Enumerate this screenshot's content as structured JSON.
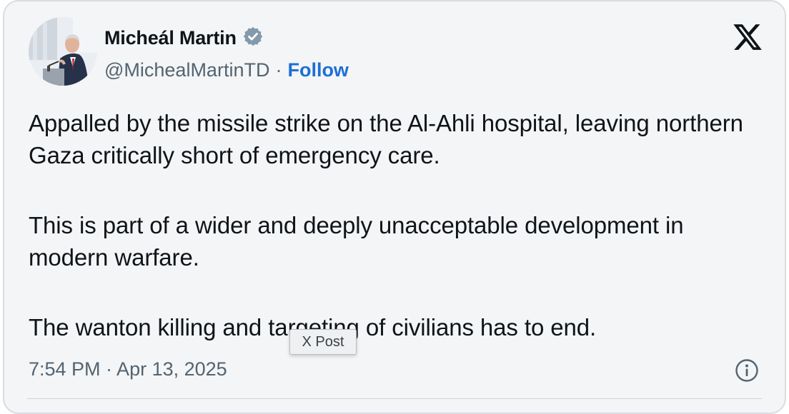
{
  "author": {
    "name": "Micheál Martin",
    "handle": "@MichealMartinTD",
    "separator": "·",
    "follow_label": "Follow",
    "verified": true
  },
  "tweet": {
    "paragraphs": [
      "Appalled by the missile strike on the Al-Ahli hospital, leaving northern Gaza critically short of emergency care.",
      "This is part of a wider and deeply unacceptable development in modern warfare.",
      "The wanton killing and targeting of civilians has to end."
    ],
    "timestamp": "7:54 PM · Apr 13, 2025"
  },
  "tooltip": {
    "text": "X Post"
  },
  "icons": {
    "brand": "x-logo-icon",
    "verified": "verified-badge-icon",
    "info": "info-icon"
  },
  "colors": {
    "follow": "#1d6fd6",
    "text": "#0f1419",
    "muted": "#536471",
    "card_bg": "#f4f5f6"
  }
}
